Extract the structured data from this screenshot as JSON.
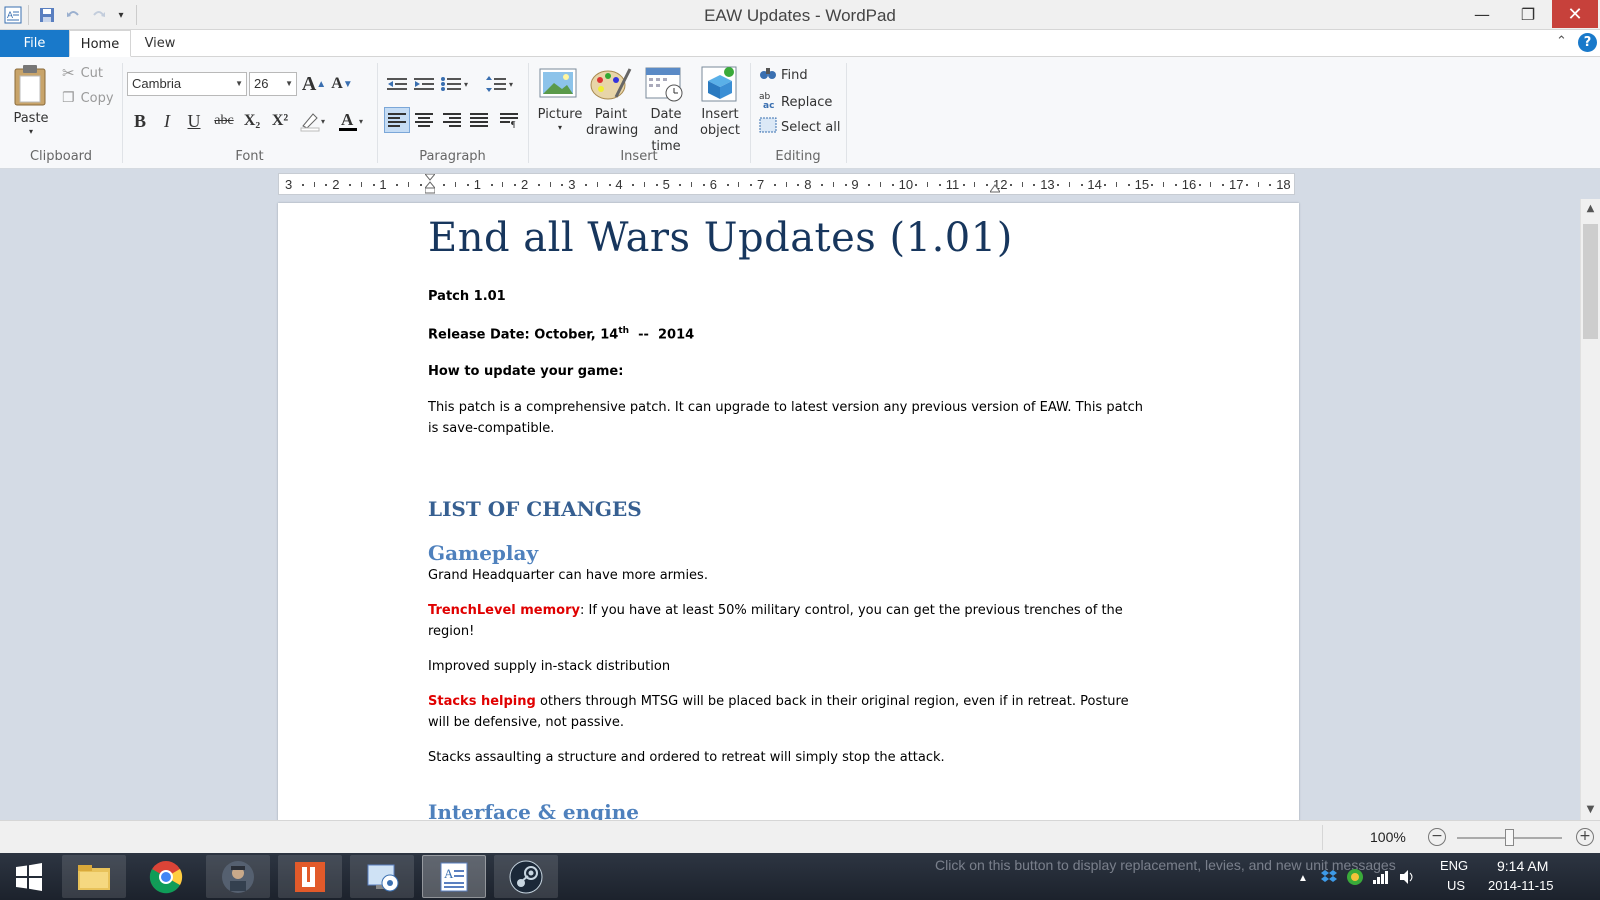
{
  "window": {
    "title": "EAW Updates - WordPad",
    "minimize": "—",
    "restore": "❐",
    "close": "✕"
  },
  "tabs": [
    {
      "label": "File"
    },
    {
      "label": "Home"
    },
    {
      "label": "View"
    }
  ],
  "ribbon": {
    "clipboard": {
      "paste": "Paste",
      "cut": "Cut",
      "copy": "Copy",
      "group": "Clipboard"
    },
    "font": {
      "family": "Cambria",
      "size": "26",
      "group": "Font",
      "bold": "B",
      "italic": "I",
      "underline": "U",
      "strike": "abc",
      "subscript": "X₂",
      "superscript": "X²",
      "grow": "A",
      "shrink": "A"
    },
    "paragraph": {
      "group": "Paragraph"
    },
    "insert": {
      "picture": "Picture",
      "paint_1": "Paint",
      "paint_2": "drawing",
      "datetime_1": "Date and",
      "datetime_2": "time",
      "object_1": "Insert",
      "object_2": "object",
      "group": "Insert"
    },
    "editing": {
      "find": "Find",
      "replace": "Replace",
      "select_all": "Select all",
      "group": "Editing"
    }
  },
  "ruler": {
    "labels": [
      "3",
      "2",
      "1",
      "",
      "1",
      "2",
      "3",
      "4",
      "5",
      "6",
      "7",
      "8",
      "9",
      "10",
      "11",
      "12",
      "13",
      "14",
      "15",
      "16",
      "17",
      "18"
    ]
  },
  "document": {
    "title": "End all Wars Updates (1.01)",
    "patch": "Patch 1.01",
    "release_prefix": "Release Date: October, 14",
    "release_sup": "th",
    "release_suffix": "  --  2014",
    "how_to": "How to update your game:",
    "intro": "This patch is a comprehensive patch. It can upgrade to latest version any previous version of EAW. This patch is save-compatible.",
    "list_heading": "LIST OF CHANGES",
    "gameplay_heading": "Gameplay",
    "gp_1": "Grand Headquarter can have more armies.",
    "gp_2_red": "TrenchLevel memory",
    "gp_2_rest": ": If you have at least 50% military control, you can get the previous trenches of the region!",
    "gp_3": "Improved supply in-stack distribution",
    "gp_4_red": "Stacks helping",
    "gp_4_rest": " others through MTSG will be placed back in their original region, even if in retreat. Posture will be defensive, not passive.",
    "gp_5": "Stacks assaulting a structure and ordered to retreat will simply stop the attack.",
    "interface_heading": "Interface & engine"
  },
  "status": {
    "zoom": "100%",
    "zoom_out": "−",
    "zoom_in": "+",
    "zoom_fraction": 0.5
  },
  "taskbar": {
    "hint": "Click on this button to display replacement, levies, and new unit messages",
    "lang": "ENG",
    "region": "US",
    "time": "9:14 AM",
    "date": "2014-11-15"
  },
  "colors": {
    "accent": "#1979ca",
    "title_text": "#17365d",
    "heading1": "#365f91",
    "heading2": "#4f81bd",
    "highlight": "#e00000"
  }
}
